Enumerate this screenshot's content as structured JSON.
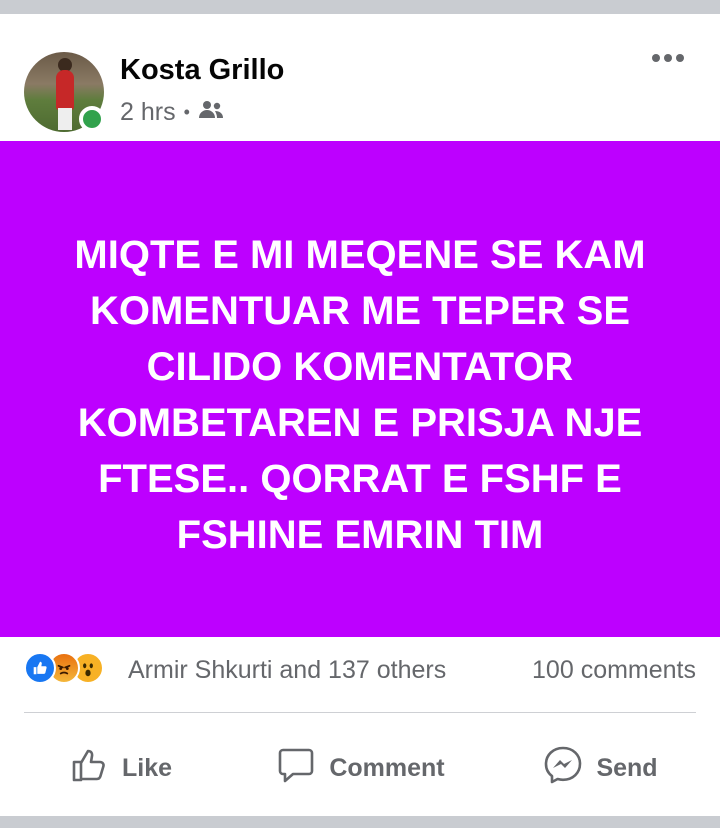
{
  "post": {
    "author": "Kosta Grillo",
    "time": "2 hrs",
    "separator": "•",
    "text": "MIQTE E MI MEQENE SE KAM KOMENTUAR ME TEPER SE CILIDO KOMENTATOR KOMBETAREN E PRISJA NJE FTESE.. QORRAT E FSHF E FSHINE EMRIN TIM",
    "background_color": "#bd00ff",
    "audience_icon": "friends-icon"
  },
  "stats": {
    "reaction_icons": [
      "like-reaction-icon",
      "angry-reaction-icon",
      "wow-reaction-icon"
    ],
    "people": "Armir Shkurti and 137 others",
    "comments": "100 comments"
  },
  "actions": {
    "like": "Like",
    "comment": "Comment",
    "send": "Send"
  },
  "colors": {
    "accent": "#1877f2",
    "online": "#31a24c",
    "muted_text": "#65676b"
  }
}
